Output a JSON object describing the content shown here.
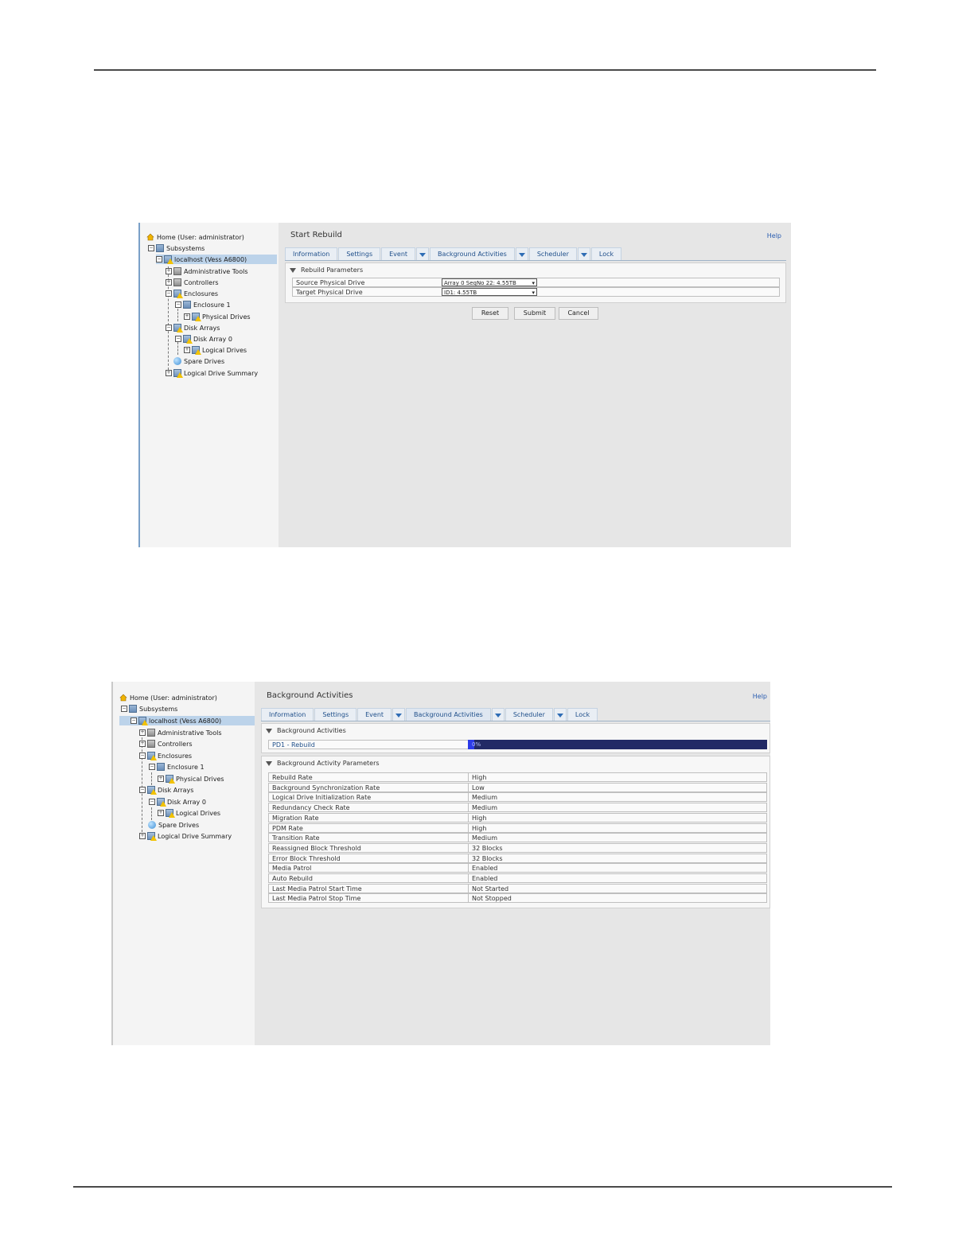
{
  "screen1": {
    "tree": [
      {
        "label": "Home (User: administrator)",
        "icon": "home-icon"
      },
      {
        "label": "Subsystems",
        "icon": "subsystem-icon"
      },
      {
        "label": "localhost (Vess A6800)",
        "icon": "warning-server-icon"
      },
      {
        "label": "Administrative Tools",
        "icon": "tools-icon"
      },
      {
        "label": "Controllers",
        "icon": "controller-icon"
      },
      {
        "label": "Enclosures",
        "icon": "warning-enclosure-icon"
      },
      {
        "label": "Enclosure 1",
        "icon": "enclosure-icon"
      },
      {
        "label": "Physical Drives",
        "icon": "warning-drive-icon"
      },
      {
        "label": "Disk Arrays",
        "icon": "warning-array-icon"
      },
      {
        "label": "Disk Array 0",
        "icon": "warning-array-icon"
      },
      {
        "label": "Logical Drives",
        "icon": "warning-logical-drive-icon"
      },
      {
        "label": "Spare Drives",
        "icon": "spare-drive-icon"
      },
      {
        "label": "Logical Drive Summary",
        "icon": "warning-summary-icon"
      }
    ],
    "title": "Start Rebuild",
    "help": "Help",
    "tabs": [
      "Information",
      "Settings",
      "Event",
      "Background Activities",
      "Scheduler",
      "Lock"
    ],
    "section": "Rebuild Parameters",
    "params": [
      {
        "label": "Source Physical Drive",
        "value": "Array 0 SeqNo 22: 4.55TB"
      },
      {
        "label": "Target Physical Drive",
        "value": "ID1: 4.55TB"
      }
    ],
    "buttons": {
      "reset": "Reset",
      "submit": "Submit",
      "cancel": "Cancel"
    }
  },
  "screen2": {
    "tree": [
      {
        "label": "Home (User: administrator)",
        "icon": "home-icon"
      },
      {
        "label": "Subsystems",
        "icon": "subsystem-icon"
      },
      {
        "label": "localhost (Vess A6800)",
        "icon": "warning-server-icon"
      },
      {
        "label": "Administrative Tools",
        "icon": "tools-icon"
      },
      {
        "label": "Controllers",
        "icon": "controller-icon"
      },
      {
        "label": "Enclosures",
        "icon": "warning-enclosure-icon"
      },
      {
        "label": "Enclosure 1",
        "icon": "enclosure-icon"
      },
      {
        "label": "Physical Drives",
        "icon": "warning-drive-icon"
      },
      {
        "label": "Disk Arrays",
        "icon": "warning-array-icon"
      },
      {
        "label": "Disk Array 0",
        "icon": "warning-array-icon"
      },
      {
        "label": "Logical Drives",
        "icon": "warning-logical-drive-icon"
      },
      {
        "label": "Spare Drives",
        "icon": "spare-drive-icon"
      },
      {
        "label": "Logical Drive Summary",
        "icon": "warning-summary-icon"
      }
    ],
    "title": "Background Activities",
    "help": "Help",
    "tabs": [
      "Information",
      "Settings",
      "Event",
      "Background Activities",
      "Scheduler",
      "Lock"
    ],
    "section1": "Background Activities",
    "activity": {
      "label": "PD1 - Rebuild",
      "progress_text": "0%",
      "progress_fraction": 0.02
    },
    "section2": "Background Activity Parameters",
    "params": [
      {
        "label": "Rebuild Rate",
        "value": "High"
      },
      {
        "label": "Background Synchronization Rate",
        "value": "Low"
      },
      {
        "label": "Logical Drive Initialization Rate",
        "value": "Medium"
      },
      {
        "label": "Redundancy Check Rate",
        "value": "Medium"
      },
      {
        "label": "Migration Rate",
        "value": "High"
      },
      {
        "label": "PDM Rate",
        "value": "High"
      },
      {
        "label": "Transition Rate",
        "value": "Medium"
      },
      {
        "label": "Reassigned Block Threshold",
        "value": "32 Blocks"
      },
      {
        "label": "Error Block Threshold",
        "value": "32 Blocks"
      },
      {
        "label": "Media Patrol",
        "value": "Enabled"
      },
      {
        "label": "Auto Rebuild",
        "value": "Enabled"
      },
      {
        "label": "Last Media Patrol Start Time",
        "value": "Not Started"
      },
      {
        "label": "Last Media Patrol Stop Time",
        "value": "Not Stopped"
      }
    ]
  },
  "colors": {
    "accent": "#2f6db5",
    "selection": "#bcd3ea",
    "progress_track": "#222a66",
    "progress_fill": "#2c3be8",
    "warning": "#f2c200"
  }
}
